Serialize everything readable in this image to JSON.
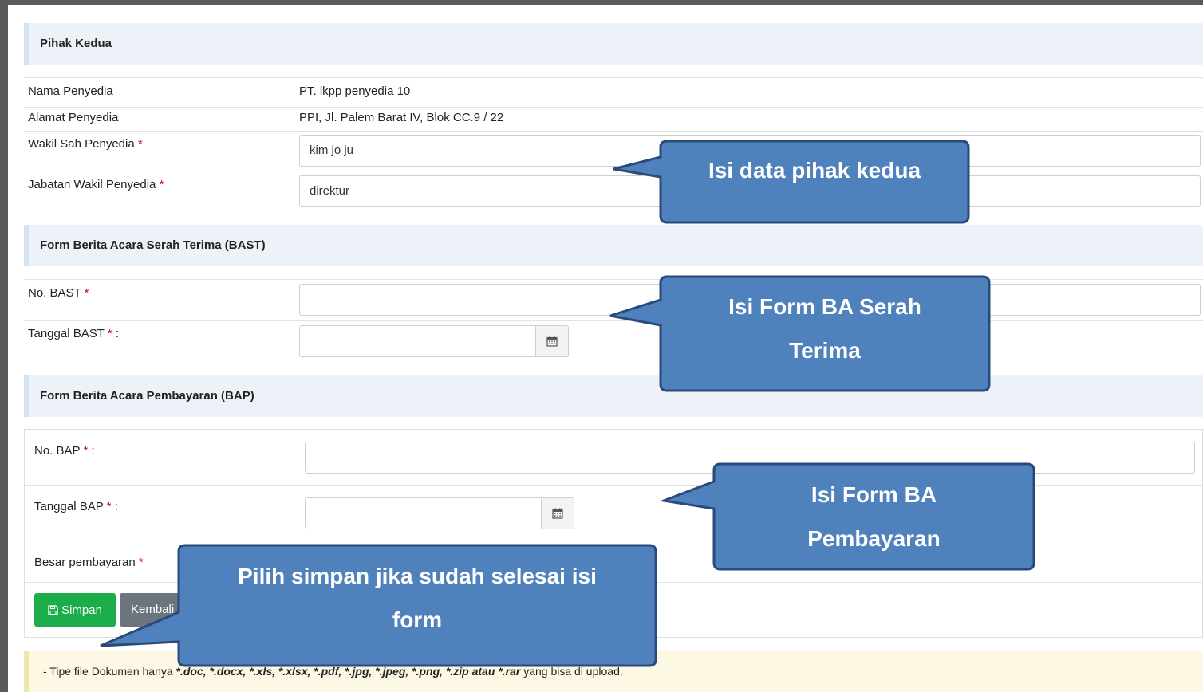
{
  "pihak_kedua": {
    "header": "Pihak Kedua",
    "nama_label": "Nama Penyedia",
    "nama_value": "PT. lkpp penyedia 10",
    "alamat_label": "Alamat Penyedia",
    "alamat_value": "PPI, Jl. Palem Barat IV, Blok CC.9 / 22",
    "wakil_label": "Wakil Sah Penyedia",
    "wakil_value": "kim jo ju",
    "jabatan_label": "Jabatan Wakil Penyedia",
    "jabatan_value": "direktur",
    "required_mark": "*"
  },
  "bast": {
    "header": "Form Berita Acara Serah Terima (BAST)",
    "no_label": "No. BAST",
    "no_value": "",
    "tanggal_label": "Tanggal BAST",
    "tanggal_suffix": ":",
    "tanggal_value": ""
  },
  "bap": {
    "header": "Form Berita Acara Pembayaran (BAP)",
    "no_label": "No. BAP",
    "no_suffix": ":",
    "no_value": "",
    "tanggal_label": "Tanggal BAP",
    "tanggal_suffix": ":",
    "tanggal_value": "",
    "besar_label": "Besar pembayaran"
  },
  "buttons": {
    "save_label": "Simpan",
    "back_label": "Kembali"
  },
  "notice": {
    "prefix": "- Tipe file Dokumen hanya ",
    "types": "*.doc, *.docx, *.xls, *.xlsx, *.pdf, *.jpg, *.jpeg, *.png, *.zip atau *.rar",
    "suffix": " yang bisa di upload."
  },
  "callouts": {
    "pihak_kedua": "Isi data pihak kedua",
    "bast_line1": "Isi Form BA Serah",
    "bast_line2": "Terima",
    "bap_line1": "Isi Form BA",
    "bap_line2": "Pembayaran",
    "simpan_line1": "Pilih simpan jika sudah selesai isi",
    "simpan_line2": "form"
  },
  "icons": {
    "calendar": "calendar-icon",
    "save": "floppy-disk-icon"
  },
  "colors": {
    "callout_fill": "#4f81bd",
    "callout_border": "#2a4a7c",
    "save_button": "#1cad4b",
    "back_button": "#6c757d",
    "required": "#d0021b",
    "section_bg": "#edf2f8",
    "notice_bg": "#fcf8e3"
  }
}
